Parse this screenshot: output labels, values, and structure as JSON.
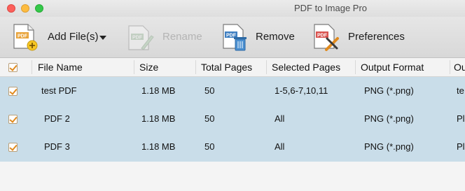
{
  "window": {
    "title": "PDF to Image Pro"
  },
  "toolbar": {
    "add_files_label": "Add File(s)",
    "rename_label": "Rename",
    "remove_label": "Remove",
    "preferences_label": "Preferences",
    "pdf_badge": "PDF"
  },
  "table": {
    "headers": [
      "File Name",
      "Size",
      "Total Pages",
      "Selected Pages",
      "Output Format",
      "Ou"
    ],
    "rows": [
      {
        "file_name": "test PDF",
        "size": "1.18 MB",
        "total_pages": "50",
        "selected_pages": "1-5,6-7,10,11",
        "output_format": "PNG (*.png)",
        "output_dir": "te",
        "checked": true
      },
      {
        "file_name": "PDF 2",
        "size": "1.18 MB",
        "total_pages": "50",
        "selected_pages": "All",
        "output_format": "PNG (*.png)",
        "output_dir": "Pl",
        "checked": true
      },
      {
        "file_name": "PDF 3",
        "size": "1.18 MB",
        "total_pages": "50",
        "selected_pages": "All",
        "output_format": "PNG (*.png)",
        "output_dir": "Pl",
        "checked": true
      }
    ],
    "select_all_checked": true
  },
  "colors": {
    "row_selected": "#c9dde9",
    "check_accent": "#e08a1e",
    "disabled_text": "#b4b4b4"
  }
}
